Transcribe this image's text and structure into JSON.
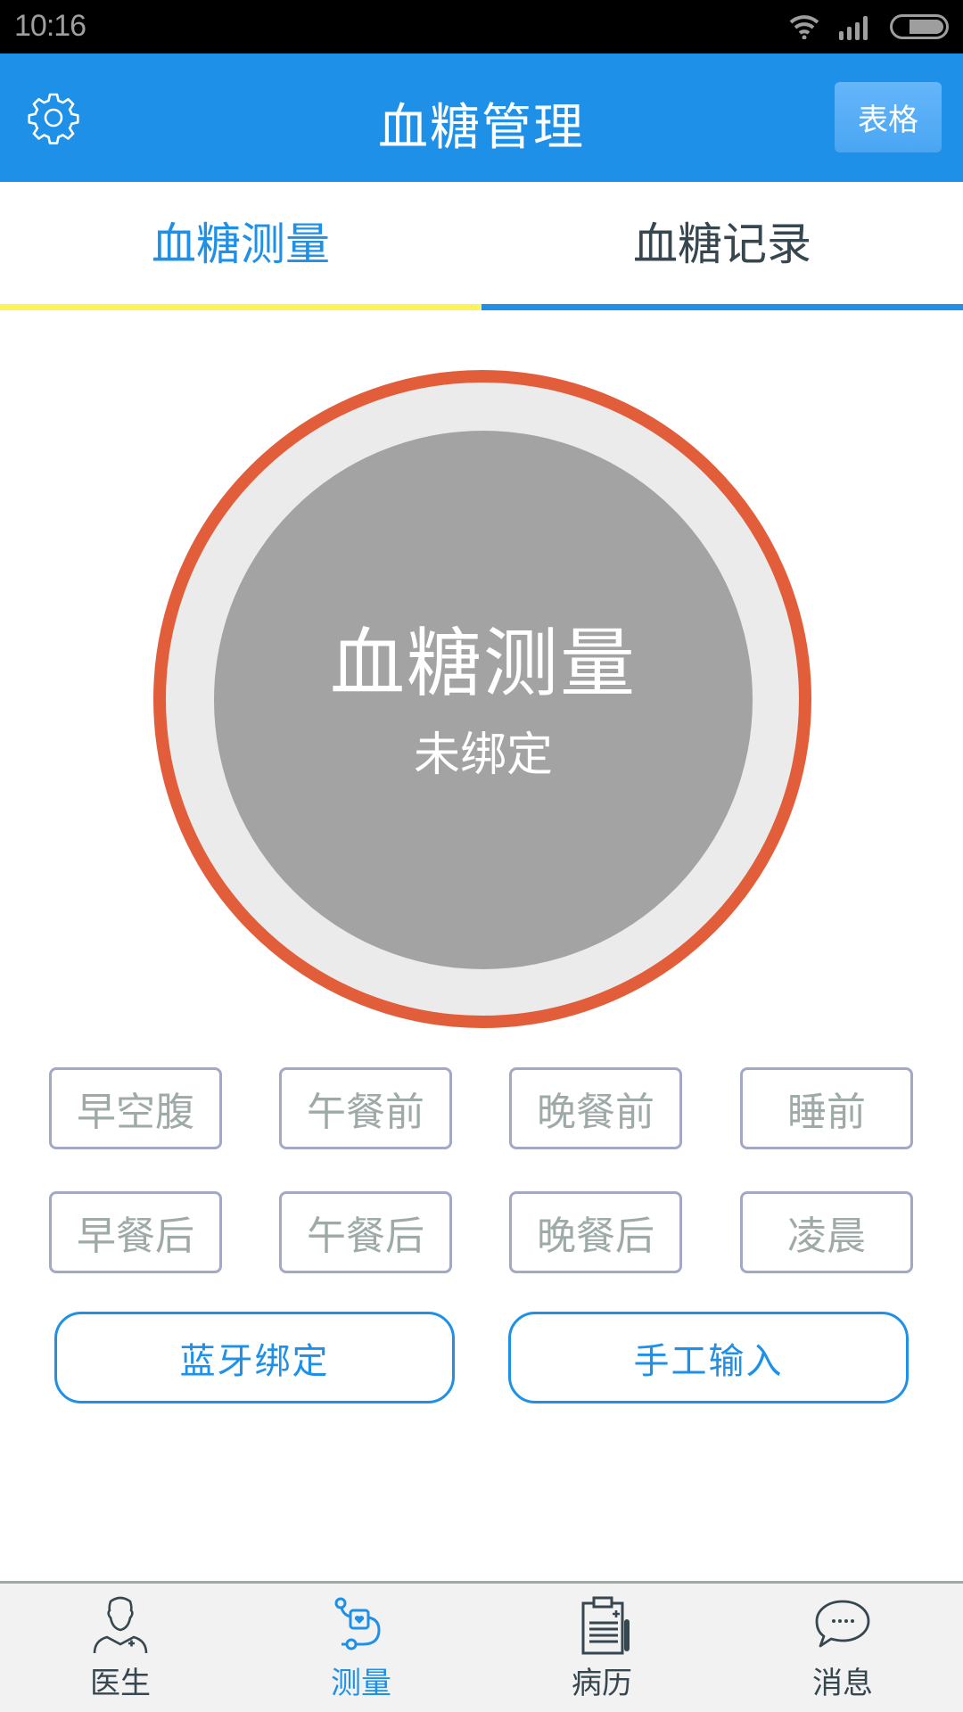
{
  "status_bar": {
    "time": "10:16",
    "icons": [
      "wifi-icon",
      "signal-icon",
      "battery-icon"
    ],
    "battery_level": 0.7
  },
  "header": {
    "title": "血糖管理",
    "left_icon": "gear-icon",
    "right_button": "表格"
  },
  "tabs": [
    {
      "label": "血糖测量",
      "active": true
    },
    {
      "label": "血糖记录",
      "active": false
    }
  ],
  "measure": {
    "title": "血糖测量",
    "status": "未绑定"
  },
  "periods": [
    [
      "早空腹",
      "午餐前",
      "晚餐前",
      "睡前"
    ],
    [
      "早餐后",
      "午餐后",
      "晚餐后",
      "凌晨"
    ]
  ],
  "actions": {
    "bluetooth_bind": "蓝牙绑定",
    "manual_input": "手工输入"
  },
  "bottom_nav": [
    {
      "label": "医生",
      "icon": "doctor-icon",
      "active": false
    },
    {
      "label": "测量",
      "icon": "blood-pressure-monitor-icon",
      "active": true
    },
    {
      "label": "病历",
      "icon": "clipboard-icon",
      "active": false
    },
    {
      "label": "消息",
      "icon": "chat-bubble-icon",
      "active": false
    }
  ],
  "colors": {
    "primary": "#1e90e8",
    "tab_indicator_active": "#fff35a",
    "ring": "#e25e3b",
    "core": "#a3a3a3",
    "period_border": "#a3a9c4",
    "period_text": "#9eaaa8",
    "nav_text": "#37474f"
  }
}
